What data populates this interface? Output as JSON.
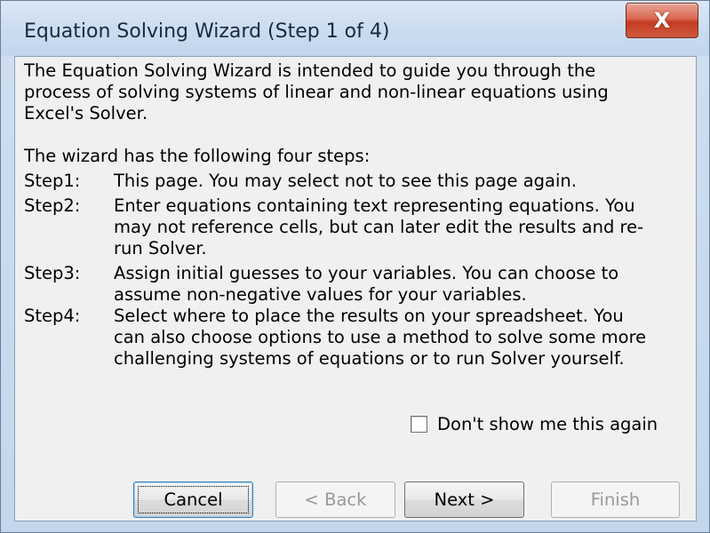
{
  "window": {
    "title": "Equation Solving Wizard (Step 1 of 4)",
    "close_glyph": "X"
  },
  "intro": {
    "line1": "The Equation Solving Wizard is intended to guide you through the",
    "line2": "process of solving systems of linear and non-linear equations using",
    "line3": "Excel's Solver.",
    "lead": "The wizard has the following four steps:"
  },
  "steps": [
    {
      "label": "Step1:",
      "lines": [
        "This page. You may select not to see this page again."
      ]
    },
    {
      "label": "Step2:",
      "lines": [
        "Enter equations containing text representing equations. You",
        "may not reference cells, but can later edit the results and re-",
        "run Solver."
      ]
    },
    {
      "label": "Step3:",
      "lines": [
        "Assign initial guesses to your variables. You can choose to",
        "assume non-negative values for your variables."
      ]
    },
    {
      "label": "Step4:",
      "lines": [
        "Select where to place the results on your spreadsheet. You",
        "can also choose options to use a method to solve some more",
        "challenging systems of equations or to run Solver yourself."
      ]
    }
  ],
  "checkbox": {
    "label": "Don't show me this again",
    "checked": false
  },
  "buttons": {
    "cancel": "Cancel",
    "back": "< Back",
    "next": "Next >",
    "finish": "Finish"
  },
  "colors": {
    "close_button": "#c43c22",
    "title_bar": "#c9dbef",
    "client_bg": "#f0f0f0"
  }
}
